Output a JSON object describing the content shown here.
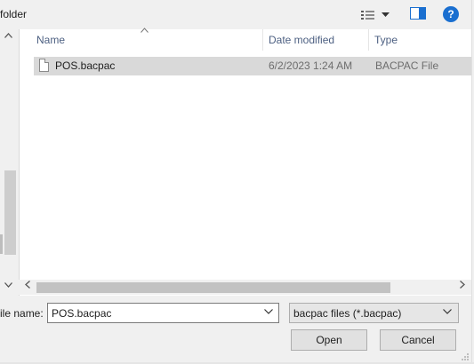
{
  "toolbar": {
    "new_folder_label": "folder",
    "view_icon": "view-options-icon",
    "pane_icon": "preview-pane-icon",
    "help_label": "?"
  },
  "columns": {
    "name": "Name",
    "date_modified": "Date modified",
    "type": "Type"
  },
  "files": [
    {
      "name": "POS.bacpac",
      "date": "6/2/2023 1:24 AM",
      "type": "BACPAC File"
    }
  ],
  "bottom": {
    "file_name_label": "ile name:",
    "file_name_value": "POS.bacpac",
    "file_type_value": "bacpac files (*.bacpac)",
    "open_label": "Open",
    "cancel_label": "Cancel"
  },
  "colors": {
    "selection": "#d9d9d9",
    "header_text": "#4d6082",
    "help_blue": "#1a6fd0"
  }
}
